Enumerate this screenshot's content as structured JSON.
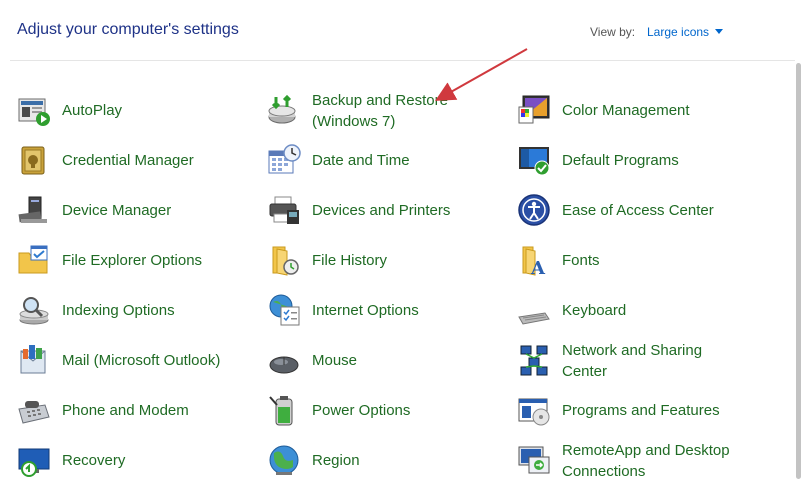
{
  "header": {
    "title": "Adjust your computer's settings",
    "view_by_label": "View by:",
    "view_by_value": "Large icons"
  },
  "items": [
    {
      "label": "AutoPlay",
      "icon": "autoplay-icon"
    },
    {
      "label": "Backup and Restore (Windows 7)",
      "icon": "backup-restore-icon"
    },
    {
      "label": "Color Management",
      "icon": "color-management-icon"
    },
    {
      "label": "Credential Manager",
      "icon": "credential-manager-icon"
    },
    {
      "label": "Date and Time",
      "icon": "calendar-clock-icon"
    },
    {
      "label": "Default Programs",
      "icon": "default-programs-icon"
    },
    {
      "label": "Device Manager",
      "icon": "device-manager-icon"
    },
    {
      "label": "Devices and Printers",
      "icon": "printer-icon"
    },
    {
      "label": "Ease of Access Center",
      "icon": "ease-of-access-icon"
    },
    {
      "label": "File Explorer Options",
      "icon": "folder-options-icon"
    },
    {
      "label": "File History",
      "icon": "file-history-icon"
    },
    {
      "label": "Fonts",
      "icon": "fonts-icon"
    },
    {
      "label": "Indexing Options",
      "icon": "indexing-icon"
    },
    {
      "label": "Internet Options",
      "icon": "internet-options-icon"
    },
    {
      "label": "Keyboard",
      "icon": "keyboard-icon"
    },
    {
      "label": "Mail (Microsoft Outlook)",
      "icon": "mail-icon"
    },
    {
      "label": "Mouse",
      "icon": "mouse-icon"
    },
    {
      "label": "Network and Sharing Center",
      "icon": "network-icon"
    },
    {
      "label": "Phone and Modem",
      "icon": "phone-modem-icon"
    },
    {
      "label": "Power Options",
      "icon": "power-options-icon"
    },
    {
      "label": "Programs and Features",
      "icon": "programs-features-icon"
    },
    {
      "label": "Recovery",
      "icon": "recovery-icon"
    },
    {
      "label": "Region",
      "icon": "region-globe-icon"
    },
    {
      "label": "RemoteApp and Desktop Connections",
      "icon": "remoteapp-icon"
    }
  ],
  "colors": {
    "title": "#1e3287",
    "link": "#1f6b24",
    "dropdown": "#0066cc",
    "annotation_arrow": "#d0393e"
  }
}
